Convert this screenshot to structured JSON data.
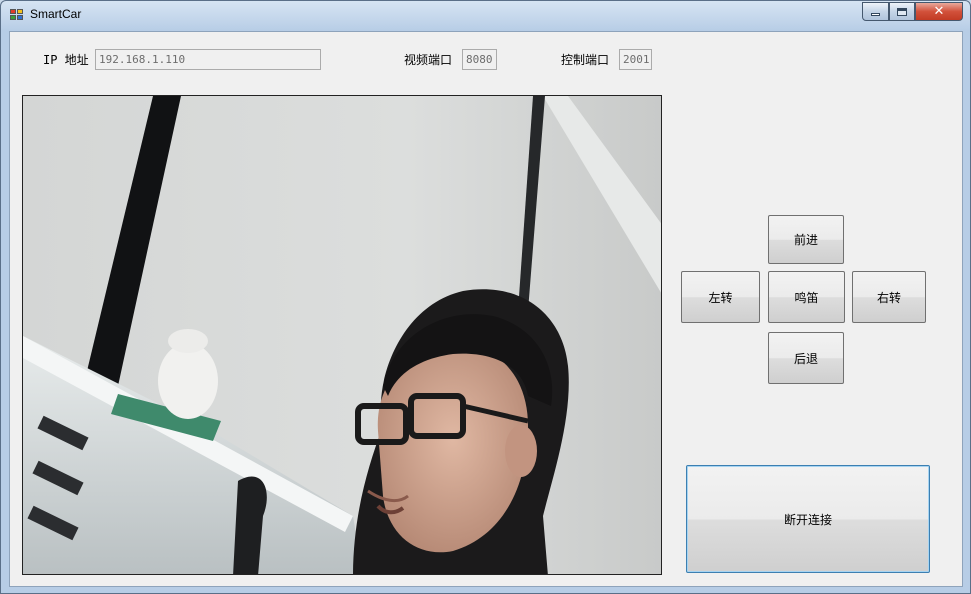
{
  "window": {
    "title": "SmartCar",
    "close_glyph": "✕"
  },
  "connection": {
    "ip_label": "IP 地址",
    "ip_value": "192.168.1.110",
    "video_port_label": "视频端口",
    "video_port_value": "8080",
    "control_port_label": "控制端口",
    "control_port_value": "2001"
  },
  "controls": {
    "forward": "前进",
    "left": "左转",
    "horn": "鸣笛",
    "right": "右转",
    "backward": "后退",
    "disconnect": "断开连接"
  },
  "colors": {
    "accent_border": "#3c7fb1",
    "close_button": "#c23b24"
  }
}
